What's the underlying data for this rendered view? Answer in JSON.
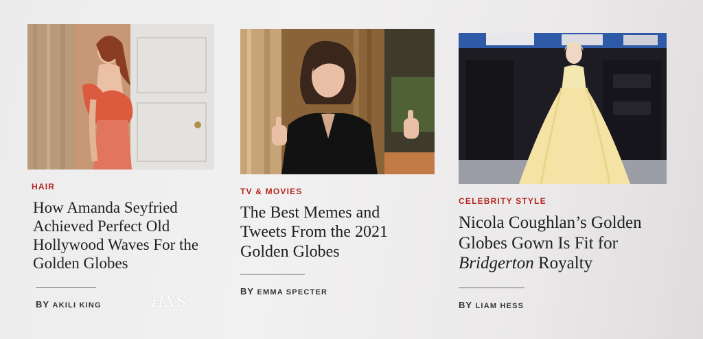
{
  "articles": [
    {
      "category": "Hair",
      "headline": "How Amanda Seyfried Achieved Perfect Old Hollywood Waves For the Golden Globes",
      "by": "BY",
      "author": "Akili King"
    },
    {
      "category": "TV & Movies",
      "headline": "The Best Memes and Tweets From the 2021 Golden Globes",
      "by": "BY",
      "author": "Emma Specter"
    },
    {
      "category": "Celebrity Style",
      "headline_part1": "Nicola Coughlan’s Golden Globes Gown Is Fit for ",
      "headline_italic": "Bridgerton",
      "headline_part2": " Royalty",
      "by": "BY",
      "author": "Liam Hess"
    }
  ],
  "watermark": "HXS...",
  "colors": {
    "category_red": "#b3261e",
    "text_dark": "#202020",
    "background": "#eeeded"
  },
  "images": [
    "photo-woman-coral-gown",
    "photo-woman-thumbs-up",
    "photo-woman-yellow-ballgown"
  ]
}
